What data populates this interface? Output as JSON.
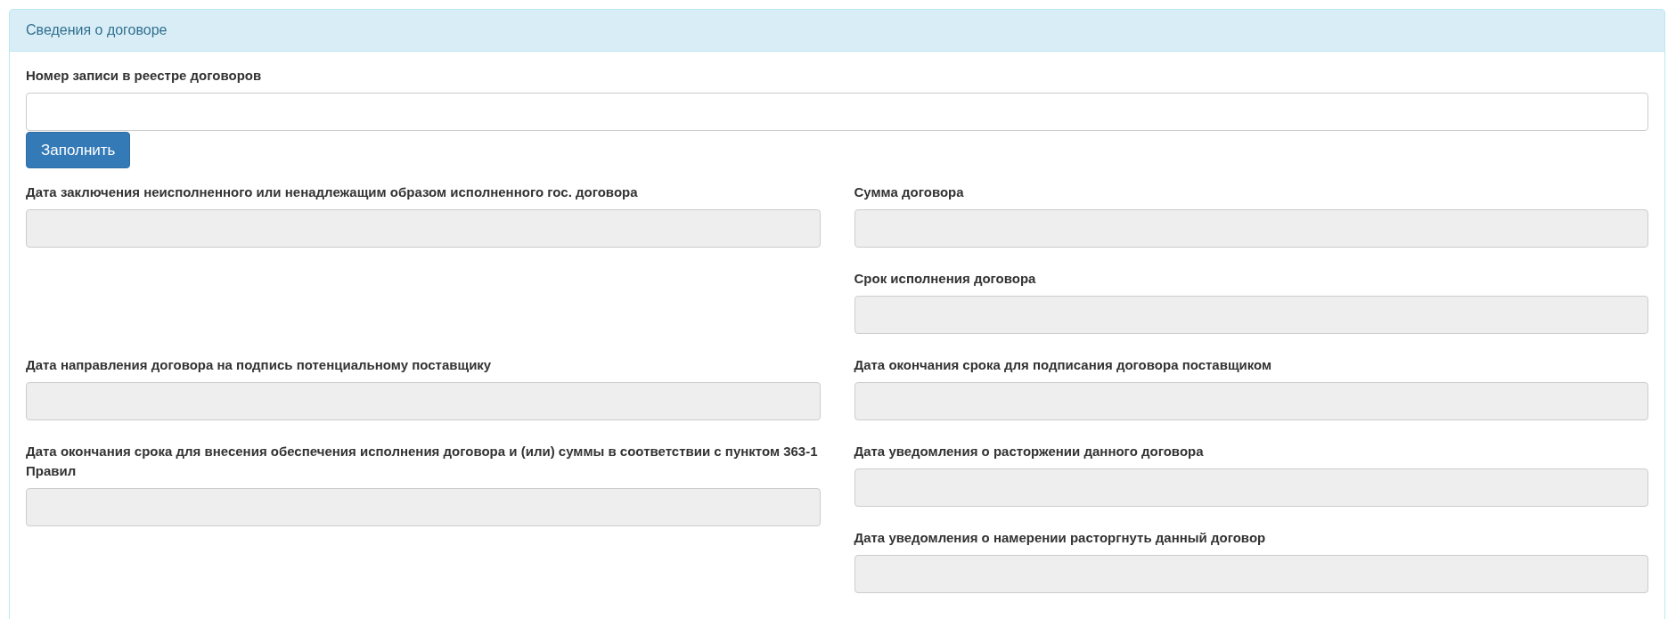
{
  "panel": {
    "title": "Сведения о договоре"
  },
  "registry": {
    "label": "Номер записи в реестре договоров",
    "disabled": false,
    "button": "Заполнить"
  },
  "rows": [
    {
      "left": [
        {
          "label": "Дата заключения неисполненного или ненадлежащим образом исполненного гос. договора",
          "disabled": true
        }
      ],
      "right": [
        {
          "label": "Сумма договора",
          "disabled": true
        },
        {
          "label": "Срок исполнения договора",
          "disabled": true
        }
      ]
    },
    {
      "left": [
        {
          "label": "Дата направления договора на подпись потенциальному поставщику",
          "disabled": true
        }
      ],
      "right": [
        {
          "label": "Дата окончания срока для подписания договора поставщиком",
          "disabled": true
        }
      ]
    },
    {
      "left": [
        {
          "label": "Дата окончания срока для внесения обеспечения исполнения договора и (или) суммы в соответствии с пунктом 363-1 Правил",
          "disabled": true
        }
      ],
      "right": [
        {
          "label": "Дата уведомления о расторжении данного договора",
          "disabled": true
        },
        {
          "label": "Дата уведомления о намерении расторгнуть данный договор",
          "disabled": true
        }
      ]
    }
  ]
}
